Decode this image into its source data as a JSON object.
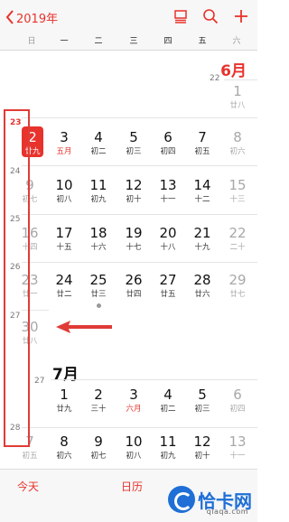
{
  "header": {
    "back_label": "2019年"
  },
  "weekdays": [
    "日",
    "一",
    "二",
    "三",
    "四",
    "五",
    "六"
  ],
  "months": {
    "june": "6月",
    "july": "7月"
  },
  "week_numbers": [
    "22",
    "23",
    "24",
    "25",
    "26",
    "27",
    "27",
    "28"
  ],
  "weeks": [
    {
      "week": "22",
      "days": [
        {
          "d": "1",
          "l": "廿八",
          "we": true
        }
      ]
    },
    {
      "week": "23",
      "days": [
        {
          "d": "2",
          "l": "廿九",
          "sel": true
        },
        {
          "d": "3",
          "l": "五月",
          "red": true
        },
        {
          "d": "4",
          "l": "初二"
        },
        {
          "d": "5",
          "l": "初三"
        },
        {
          "d": "6",
          "l": "初四"
        },
        {
          "d": "7",
          "l": "初五"
        },
        {
          "d": "8",
          "l": "初六",
          "we": true
        }
      ]
    },
    {
      "week": "24",
      "days": [
        {
          "d": "9",
          "l": "初七",
          "we": true
        },
        {
          "d": "10",
          "l": "初八"
        },
        {
          "d": "11",
          "l": "初九"
        },
        {
          "d": "12",
          "l": "初十"
        },
        {
          "d": "13",
          "l": "十一"
        },
        {
          "d": "14",
          "l": "十二"
        },
        {
          "d": "15",
          "l": "十三",
          "we": true
        }
      ]
    },
    {
      "week": "25",
      "days": [
        {
          "d": "16",
          "l": "十四",
          "we": true
        },
        {
          "d": "17",
          "l": "十五"
        },
        {
          "d": "18",
          "l": "十六"
        },
        {
          "d": "19",
          "l": "十七"
        },
        {
          "d": "20",
          "l": "十八"
        },
        {
          "d": "21",
          "l": "十九"
        },
        {
          "d": "22",
          "l": "二十",
          "we": true
        }
      ]
    },
    {
      "week": "26",
      "days": [
        {
          "d": "23",
          "l": "廿一",
          "we": true
        },
        {
          "d": "24",
          "l": "廿二"
        },
        {
          "d": "25",
          "l": "廿三"
        },
        {
          "d": "26",
          "l": "廿四"
        },
        {
          "d": "27",
          "l": "廿五"
        },
        {
          "d": "28",
          "l": "廿六"
        },
        {
          "d": "29",
          "l": "廿七",
          "we": true
        }
      ]
    },
    {
      "week": "27",
      "days": [
        {
          "d": "30",
          "l": "廿八",
          "we": true
        }
      ]
    },
    {
      "week": "27",
      "days": [
        {
          "d": "1",
          "l": "廿九"
        },
        {
          "d": "2",
          "l": "三十"
        },
        {
          "d": "3",
          "l": "六月",
          "red": true
        },
        {
          "d": "4",
          "l": "初二"
        },
        {
          "d": "5",
          "l": "初三"
        },
        {
          "d": "6",
          "l": "初四",
          "we": true
        }
      ]
    },
    {
      "week": "28",
      "days": [
        {
          "d": "7",
          "l": "初五",
          "we": true
        },
        {
          "d": "8",
          "l": "初六"
        },
        {
          "d": "9",
          "l": "初七"
        },
        {
          "d": "10",
          "l": "初八"
        },
        {
          "d": "11",
          "l": "初九"
        },
        {
          "d": "12",
          "l": "初十"
        },
        {
          "d": "13",
          "l": "十一",
          "we": true
        }
      ]
    }
  ],
  "bottom": {
    "today": "今天",
    "calendars": "日历"
  },
  "watermark": {
    "brand": "恰卡网",
    "url": "qiaqa.com"
  },
  "colors": {
    "accent": "#e8322c",
    "annotation": "#e03b36"
  },
  "icons": [
    "back-chevron-icon",
    "list-view-icon",
    "search-icon",
    "add-icon"
  ]
}
